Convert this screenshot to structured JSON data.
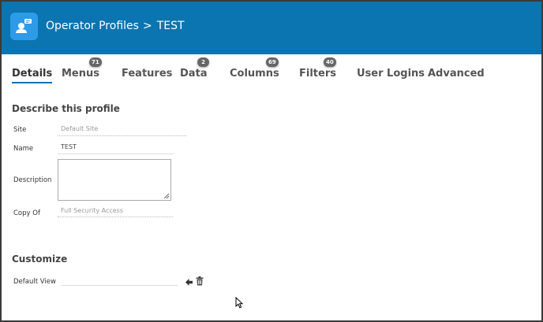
{
  "header": {
    "breadcrumb_parent": "Operator Profiles",
    "separator": ">",
    "current": "TEST",
    "icon": "operator-profile-icon",
    "bg_color": "#0b75b1",
    "icon_bg_color": "#2d9be8"
  },
  "tabs": [
    {
      "label": "Details",
      "badge": null,
      "active": true
    },
    {
      "label": "Menus",
      "badge": "71"
    },
    {
      "label": "Features",
      "badge": null
    },
    {
      "label": "Data",
      "badge": "2"
    },
    {
      "label": "Columns",
      "badge": "69"
    },
    {
      "label": "Filters",
      "badge": "40"
    },
    {
      "label": "User Logins",
      "badge": null
    },
    {
      "label": "Advanced",
      "badge": null
    }
  ],
  "describe": {
    "title": "Describe this profile",
    "site_label": "Site",
    "site_placeholder": "Default Site",
    "name_label": "Name",
    "name_value": "TEST",
    "description_label": "Description",
    "description_value": "",
    "copy_of_label": "Copy Of",
    "copy_of_placeholder": "Full Security Access"
  },
  "customize": {
    "title": "Customize",
    "default_view_label": "Default View",
    "default_view_value": "",
    "back_icon": "arrow-left-icon",
    "delete_icon": "trash-icon"
  }
}
